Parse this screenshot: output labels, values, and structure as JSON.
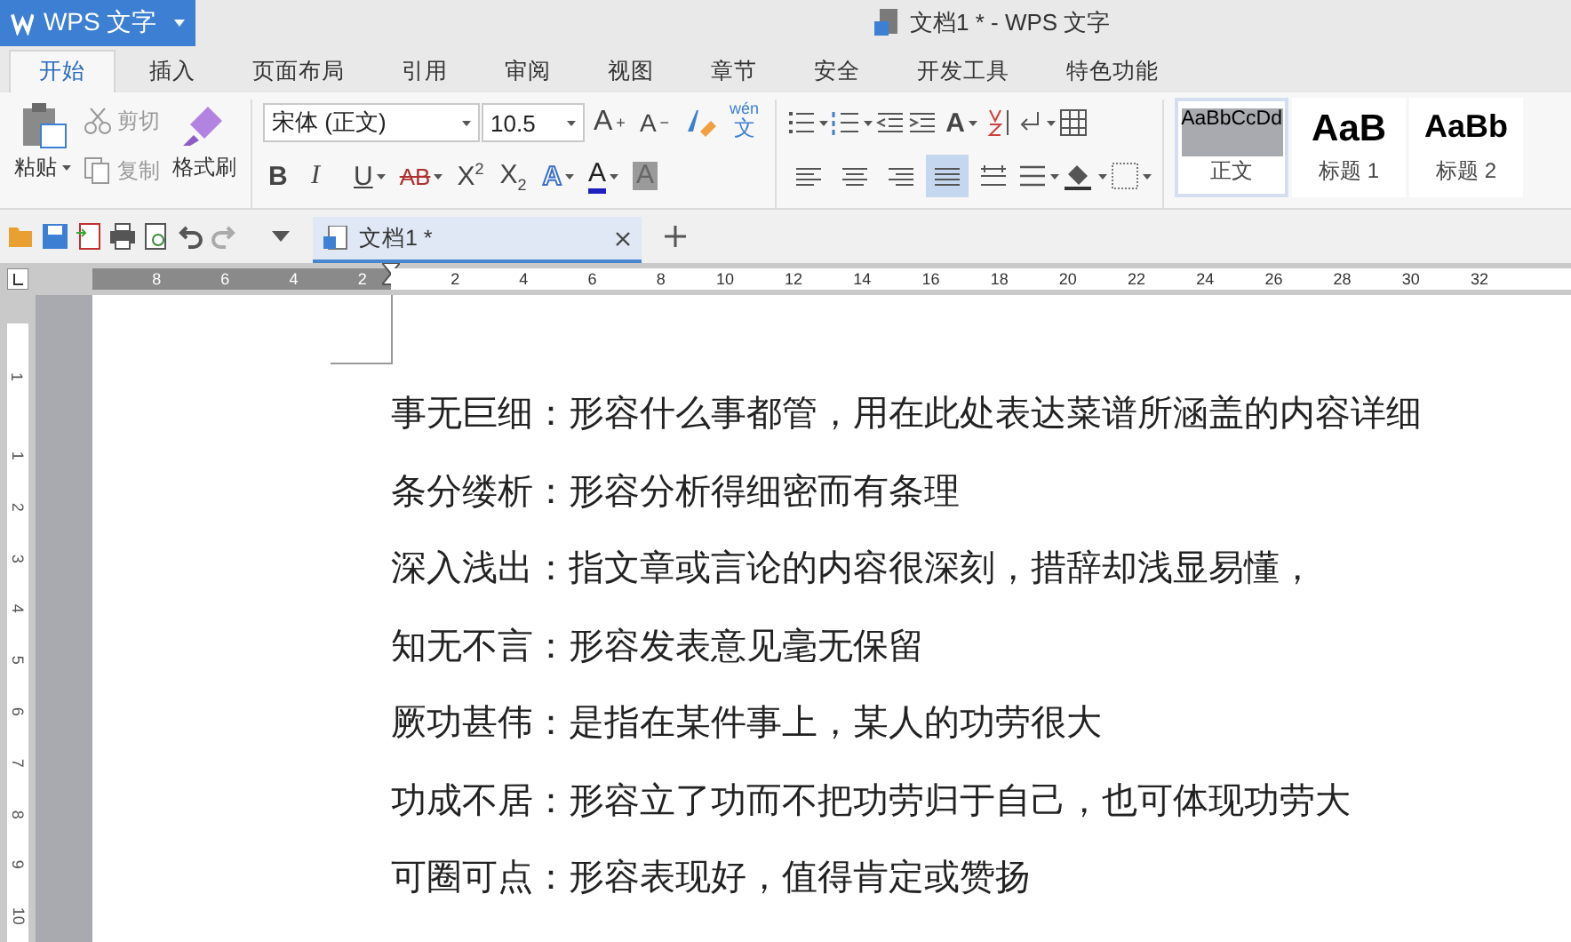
{
  "app_menu": {
    "label": "WPS 文字"
  },
  "window": {
    "title": "文档1 * - WPS 文字"
  },
  "tabs": [
    {
      "label": "开始",
      "selected": true
    },
    {
      "label": "插入",
      "selected": false
    },
    {
      "label": "页面布局",
      "selected": false
    },
    {
      "label": "引用",
      "selected": false
    },
    {
      "label": "审阅",
      "selected": false
    },
    {
      "label": "视图",
      "selected": false
    },
    {
      "label": "章节",
      "selected": false
    },
    {
      "label": "安全",
      "selected": false
    },
    {
      "label": "开发工具",
      "selected": false
    },
    {
      "label": "特色功能",
      "selected": false
    }
  ],
  "clipboard": {
    "paste": "粘贴",
    "cut": "剪切",
    "copy": "复制",
    "format_painter": "格式刷",
    "cut_disabled": true,
    "copy_disabled": true
  },
  "font": {
    "family": "宋体 (正文)",
    "size": "10.5",
    "grow": "A",
    "grow_mark": "+",
    "shrink": "A",
    "shrink_mark": "−",
    "phonetic": "wén",
    "phonetic_char": "文"
  },
  "format_buttons": [
    {
      "label": "B",
      "kind": "bold"
    },
    {
      "label": "I",
      "kind": "italic"
    },
    {
      "label": "U",
      "kind": "underline"
    },
    {
      "label": "AB",
      "kind": "strike"
    },
    {
      "label": "X$^{2}$",
      "kind": "super"
    },
    {
      "label": "X$_{2}$",
      "kind": "sub"
    },
    {
      "label": "A",
      "kind": "effect"
    },
    {
      "label": "A",
      "kind": "color"
    },
    {
      "label": "A",
      "kind": "shade"
    }
  ],
  "para_style_letter": "A",
  "align_buttons": [
    {
      "selected": false
    },
    {
      "selected": false
    },
    {
      "selected": false
    },
    {
      "selected": true
    },
    {
      "selected": false
    }
  ],
  "styles": [
    {
      "preview": "AaBbCcDd",
      "name": "正文",
      "kind": "body",
      "selected": true
    },
    {
      "preview": "AaB",
      "name": "标题 1",
      "kind": "h1",
      "selected": false
    },
    {
      "preview": "AaBb",
      "name": "标题 2",
      "kind": "h2",
      "selected": false
    }
  ],
  "doc_tabs": [
    {
      "label": "文档1 *",
      "selected": true
    }
  ],
  "ruler": {
    "left_labels": [
      "8",
      "6",
      "4",
      "2"
    ],
    "right_labels": [
      "2",
      "4",
      "6",
      "8",
      "10",
      "12",
      "14",
      "16",
      "18",
      "20",
      "22",
      "24",
      "26",
      "28",
      "30",
      "32"
    ]
  },
  "vruler_labels": [
    "1",
    "1",
    "2",
    "3",
    "4",
    "5",
    "6",
    "7",
    "8",
    "9",
    "10"
  ],
  "paragraphs": [
    "事无巨细：形容什么事都管，用在此处表达菜谱所涵盖的内容详细",
    "条分缕析：形容分析得细密而有条理",
    "深入浅出：指文章或言论的内容很深刻，措辞却浅显易懂，",
    "知无不言：形容发表意见毫无保留",
    "厥功甚伟：是指在某件事上，某人的功劳很大",
    "功成不居：形容立了功而不把功劳归于自己，也可体现功劳大",
    "可圈可点：形容表现好，值得肯定或赞扬"
  ]
}
